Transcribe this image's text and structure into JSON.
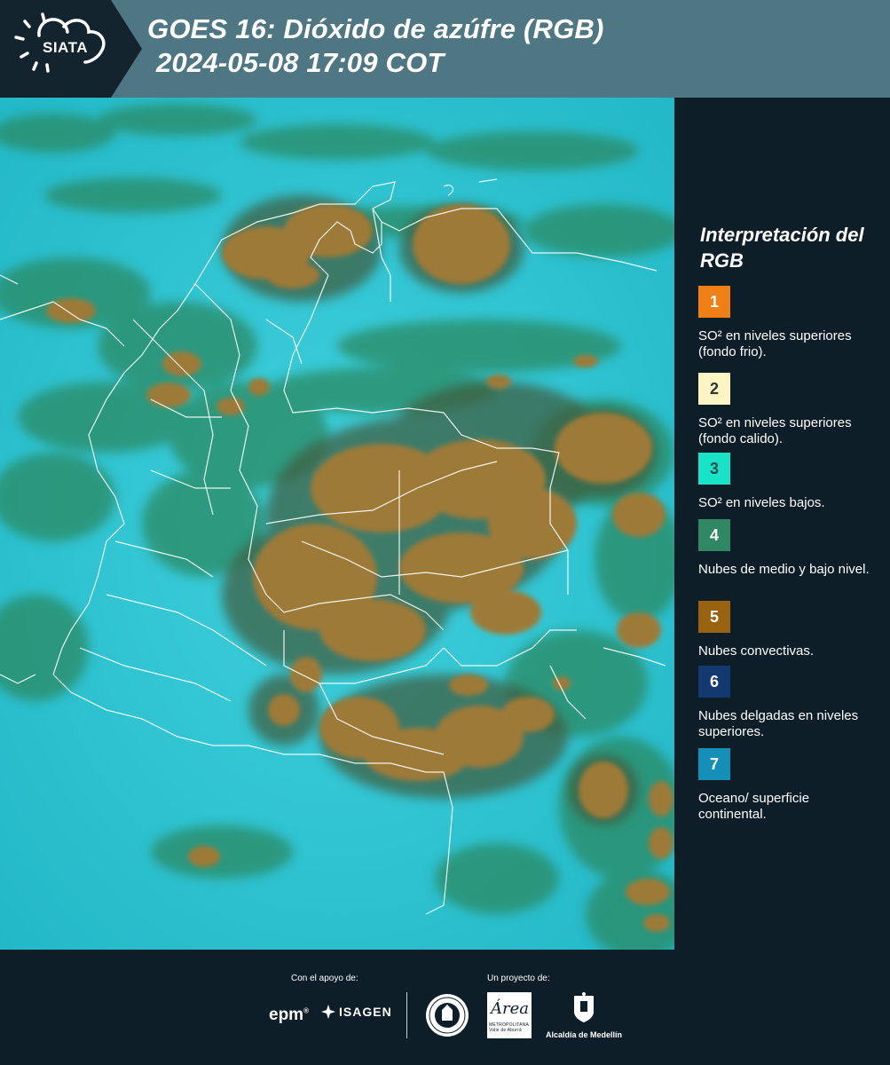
{
  "header": {
    "logo_text": "SIATA",
    "title_line1": "GOES 16: Dióxido de azúfre (RGB)",
    "title_line2": "2024-05-08 17:09 COT",
    "background_color": "#4f7683"
  },
  "map": {
    "type": "satellite RGB composite",
    "layer": "Dióxido de azúfre (RGB)",
    "colors": {
      "ocean": "#2ec6d3",
      "convective_clouds": "#9e7a38",
      "mid_low_clouds": "#2c8c6a",
      "borders": "#ffffff"
    }
  },
  "legend": {
    "title": "Interpretación del RGB",
    "items": [
      {
        "number": "1",
        "color": "#f07f16",
        "text": "SO² en niveles superiores (fondo frio)."
      },
      {
        "number": "2",
        "color": "#fdf5c4",
        "text": "SO² en niveles superiores (fondo calido)."
      },
      {
        "number": "3",
        "color": "#19e3c6",
        "text": "SO² en niveles bajos."
      },
      {
        "number": "4",
        "color": "#2f8863",
        "text": "Nubes de medio y bajo nivel."
      },
      {
        "number": "5",
        "color": "#99620e",
        "text": "Nubes convectivas."
      },
      {
        "number": "6",
        "color": "#133a70",
        "text": "Nubes delgadas en niveles superiores."
      },
      {
        "number": "7",
        "color": "#138fb8",
        "text": "Oceano/ superficie continental."
      }
    ]
  },
  "footer": {
    "support_label": "Con el apoyo de:",
    "project_label": "Un proyecto de:",
    "sponsors": [
      "epm",
      "ISAGEN"
    ],
    "partners": {
      "area_text": "Área",
      "area_subtext": "METROPOLITANA Valle de Aburrá",
      "alcaldia_text": "Alcaldía de Medellín"
    }
  }
}
